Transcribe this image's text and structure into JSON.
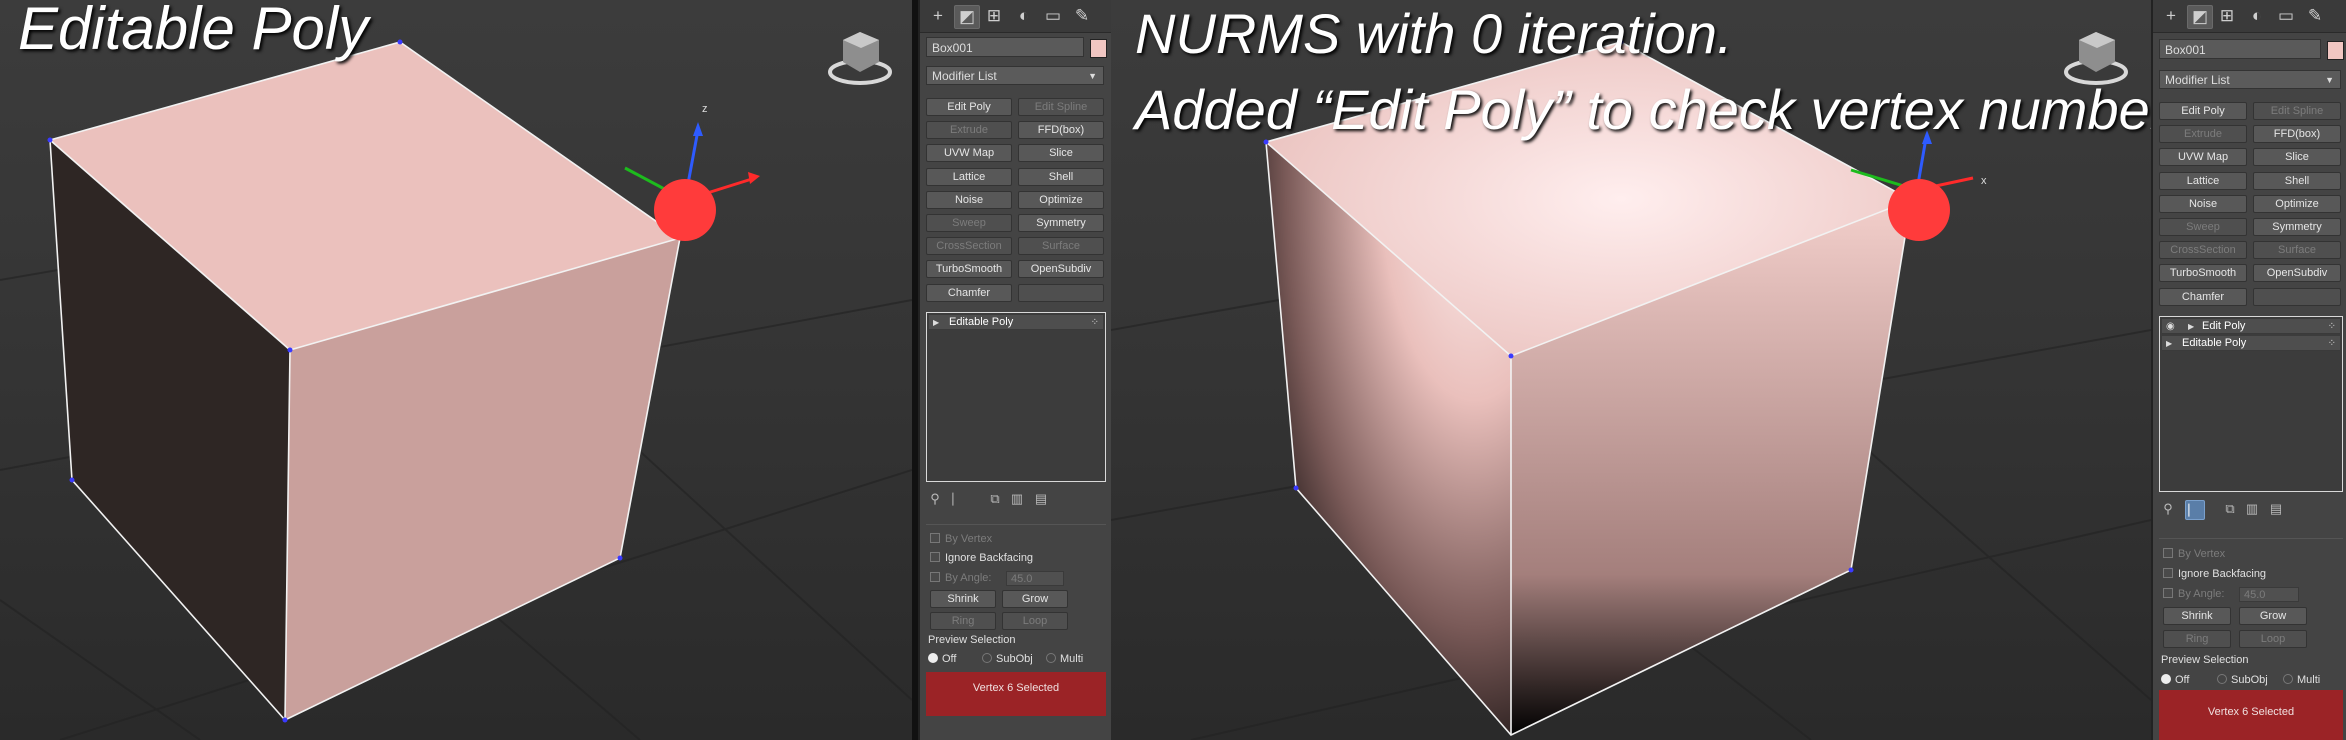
{
  "left": {
    "caption_lines": [
      "Editable Poly"
    ],
    "object_name": "Box001",
    "modifier_list_label": "Modifier List",
    "buttons": [
      {
        "label": "Edit Poly",
        "enabled": true
      },
      {
        "label": "Edit Spline",
        "enabled": false
      },
      {
        "label": "Extrude",
        "enabled": false
      },
      {
        "label": "FFD(box)",
        "enabled": true
      },
      {
        "label": "UVW Map",
        "enabled": true
      },
      {
        "label": "Slice",
        "enabled": true
      },
      {
        "label": "Lattice",
        "enabled": true
      },
      {
        "label": "Shell",
        "enabled": true
      },
      {
        "label": "Noise",
        "enabled": true
      },
      {
        "label": "Optimize",
        "enabled": true
      },
      {
        "label": "Sweep",
        "enabled": false
      },
      {
        "label": "Symmetry",
        "enabled": true
      },
      {
        "label": "CrossSection",
        "enabled": false
      },
      {
        "label": "Surface",
        "enabled": false
      },
      {
        "label": "TurboSmooth",
        "enabled": true
      },
      {
        "label": "OpenSubdiv",
        "enabled": true
      },
      {
        "label": "Chamfer",
        "enabled": true
      },
      {
        "label": "",
        "enabled": false
      }
    ],
    "stack": [
      {
        "label": "Editable Poly",
        "eye": false
      }
    ],
    "selection": {
      "by_vertex": "By Vertex",
      "ignore_backfacing": "Ignore Backfacing",
      "by_angle": "By Angle:",
      "angle_value": "45.0",
      "shrink": "Shrink",
      "grow": "Grow",
      "ring": "Ring",
      "loop": "Loop",
      "preview_selection": "Preview Selection",
      "preview_options": [
        "Off",
        "SubObj",
        "Multi"
      ],
      "preview_selected": "Off"
    },
    "status": "Vertex 6 Selected"
  },
  "right": {
    "caption_lines": [
      "NURMS with 0 iteration.",
      "Added “Edit Poly”  to check vertex numbers"
    ],
    "object_name": "Box001",
    "modifier_list_label": "Modifier List",
    "buttons": [
      {
        "label": "Edit Poly",
        "enabled": true
      },
      {
        "label": "Edit Spline",
        "enabled": false
      },
      {
        "label": "Extrude",
        "enabled": false
      },
      {
        "label": "FFD(box)",
        "enabled": true
      },
      {
        "label": "UVW Map",
        "enabled": true
      },
      {
        "label": "Slice",
        "enabled": true
      },
      {
        "label": "Lattice",
        "enabled": true
      },
      {
        "label": "Shell",
        "enabled": true
      },
      {
        "label": "Noise",
        "enabled": true
      },
      {
        "label": "Optimize",
        "enabled": true
      },
      {
        "label": "Sweep",
        "enabled": false
      },
      {
        "label": "Symmetry",
        "enabled": true
      },
      {
        "label": "CrossSection",
        "enabled": false
      },
      {
        "label": "Surface",
        "enabled": false
      },
      {
        "label": "TurboSmooth",
        "enabled": true
      },
      {
        "label": "OpenSubdiv",
        "enabled": true
      },
      {
        "label": "Chamfer",
        "enabled": true
      },
      {
        "label": "",
        "enabled": false
      }
    ],
    "stack": [
      {
        "label": "Edit Poly",
        "eye": true
      },
      {
        "label": "Editable Poly",
        "eye": false
      }
    ],
    "selection": {
      "by_vertex": "By Vertex",
      "ignore_backfacing": "Ignore Backfacing",
      "by_angle": "By Angle:",
      "angle_value": "45.0",
      "shrink": "Shrink",
      "grow": "Grow",
      "ring": "Ring",
      "loop": "Loop",
      "preview_selection": "Preview Selection",
      "preview_options": [
        "Off",
        "SubObj",
        "Multi"
      ],
      "preview_selected": "Off"
    },
    "status": "Vertex 6 Selected"
  },
  "gizmo_axes": {
    "z": "z",
    "x": "x"
  },
  "colors": {
    "box_top": "#ebc1bd",
    "box_right": "#c9a09c",
    "box_left": "#2e2624",
    "selected_vertex": "#ff3b3b",
    "status_bg": "#9b2326",
    "swatch": "#f1c6c2"
  }
}
